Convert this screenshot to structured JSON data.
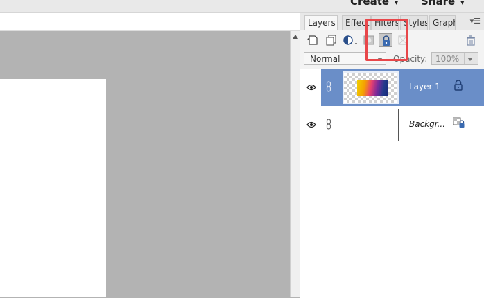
{
  "topbar": {
    "create_label": "Create",
    "share_label": "Share",
    "caret": "▾"
  },
  "panel": {
    "tabs": [
      {
        "label": "Layers",
        "active": true
      },
      {
        "label": "Effects",
        "active": false
      },
      {
        "label": "Filters",
        "active": false
      },
      {
        "label": "Styles",
        "active": false
      },
      {
        "label": "Graph",
        "active": false
      }
    ],
    "menu_icon": "panel-menu-icon",
    "toolbar": {
      "icons": [
        "new-layer-icon",
        "new-group-icon",
        "adjustment-layer-icon",
        "layer-mask-icon",
        "lock-all-icon",
        "lock-transparent-icon",
        "trash-icon"
      ],
      "pressed": "lock-all-icon"
    },
    "blend_mode": "Normal",
    "opacity_label": "Opacity:",
    "opacity_value": "100%"
  },
  "layers": [
    {
      "name": "Layer 1",
      "selected": true,
      "thumbnail": "gradient",
      "lock": "lock-icon",
      "visible": true
    },
    {
      "name": "Backgr...",
      "selected": false,
      "thumbnail": "white",
      "lock": "background-lock-icon",
      "visible": true
    }
  ],
  "highlight": {
    "color": "#e8474a",
    "target": "lock-all-icon"
  },
  "colors": {
    "selected_row": "#6a8ec8",
    "canvas_bg": "#b3b3b3",
    "highlight": "#e8474a"
  }
}
